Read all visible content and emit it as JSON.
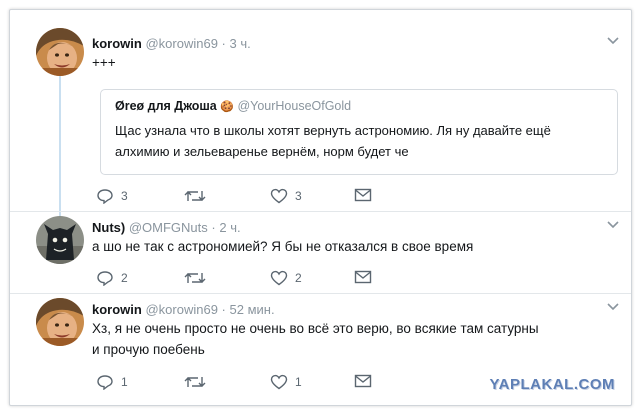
{
  "tweets": [
    {
      "name": "korowin",
      "handle": "@korowin69",
      "dot": "·",
      "time": "3 ч.",
      "text": "+++",
      "quote": {
        "name": "Øreø для Джоша",
        "emoji": "🍪",
        "handle": "@YourHouseOfGold",
        "text_line1": "Щас узнала что в школы хотят вернуть астрономию. Ля ну давайте ещё",
        "text_line2": "алхимию и зельеваренье вернём, норм будет че"
      },
      "actions": {
        "replies": "3",
        "retweets": "",
        "likes": "3"
      }
    },
    {
      "name": "Nuts)",
      "handle": "@OMFGNuts",
      "dot": "·",
      "time": "2 ч.",
      "text": "а шо не так  с астрономией? Я бы не отказался в свое время",
      "actions": {
        "replies": "2",
        "retweets": "",
        "likes": "2"
      }
    },
    {
      "name": "korowin",
      "handle": "@korowin69",
      "dot": "·",
      "time": "52 мин.",
      "text_line1": "Хз, я не очень просто не очень во всё это верю, во всякие там сатурны",
      "text_line2": "и прочую поебень",
      "actions": {
        "replies": "1",
        "retweets": "",
        "likes": "1"
      }
    }
  ],
  "icons": {
    "reply": "reply-icon",
    "retweet": "retweet-icon",
    "like": "heart-icon",
    "dm": "envelope-icon",
    "caret": "chevron-down-icon"
  },
  "watermark": "YAPLAKAL.COM",
  "colors": {
    "text": "#14171a",
    "secondary": "#8a959e",
    "thread_line": "#c9dff0",
    "watermark": "#5e7fb5"
  }
}
